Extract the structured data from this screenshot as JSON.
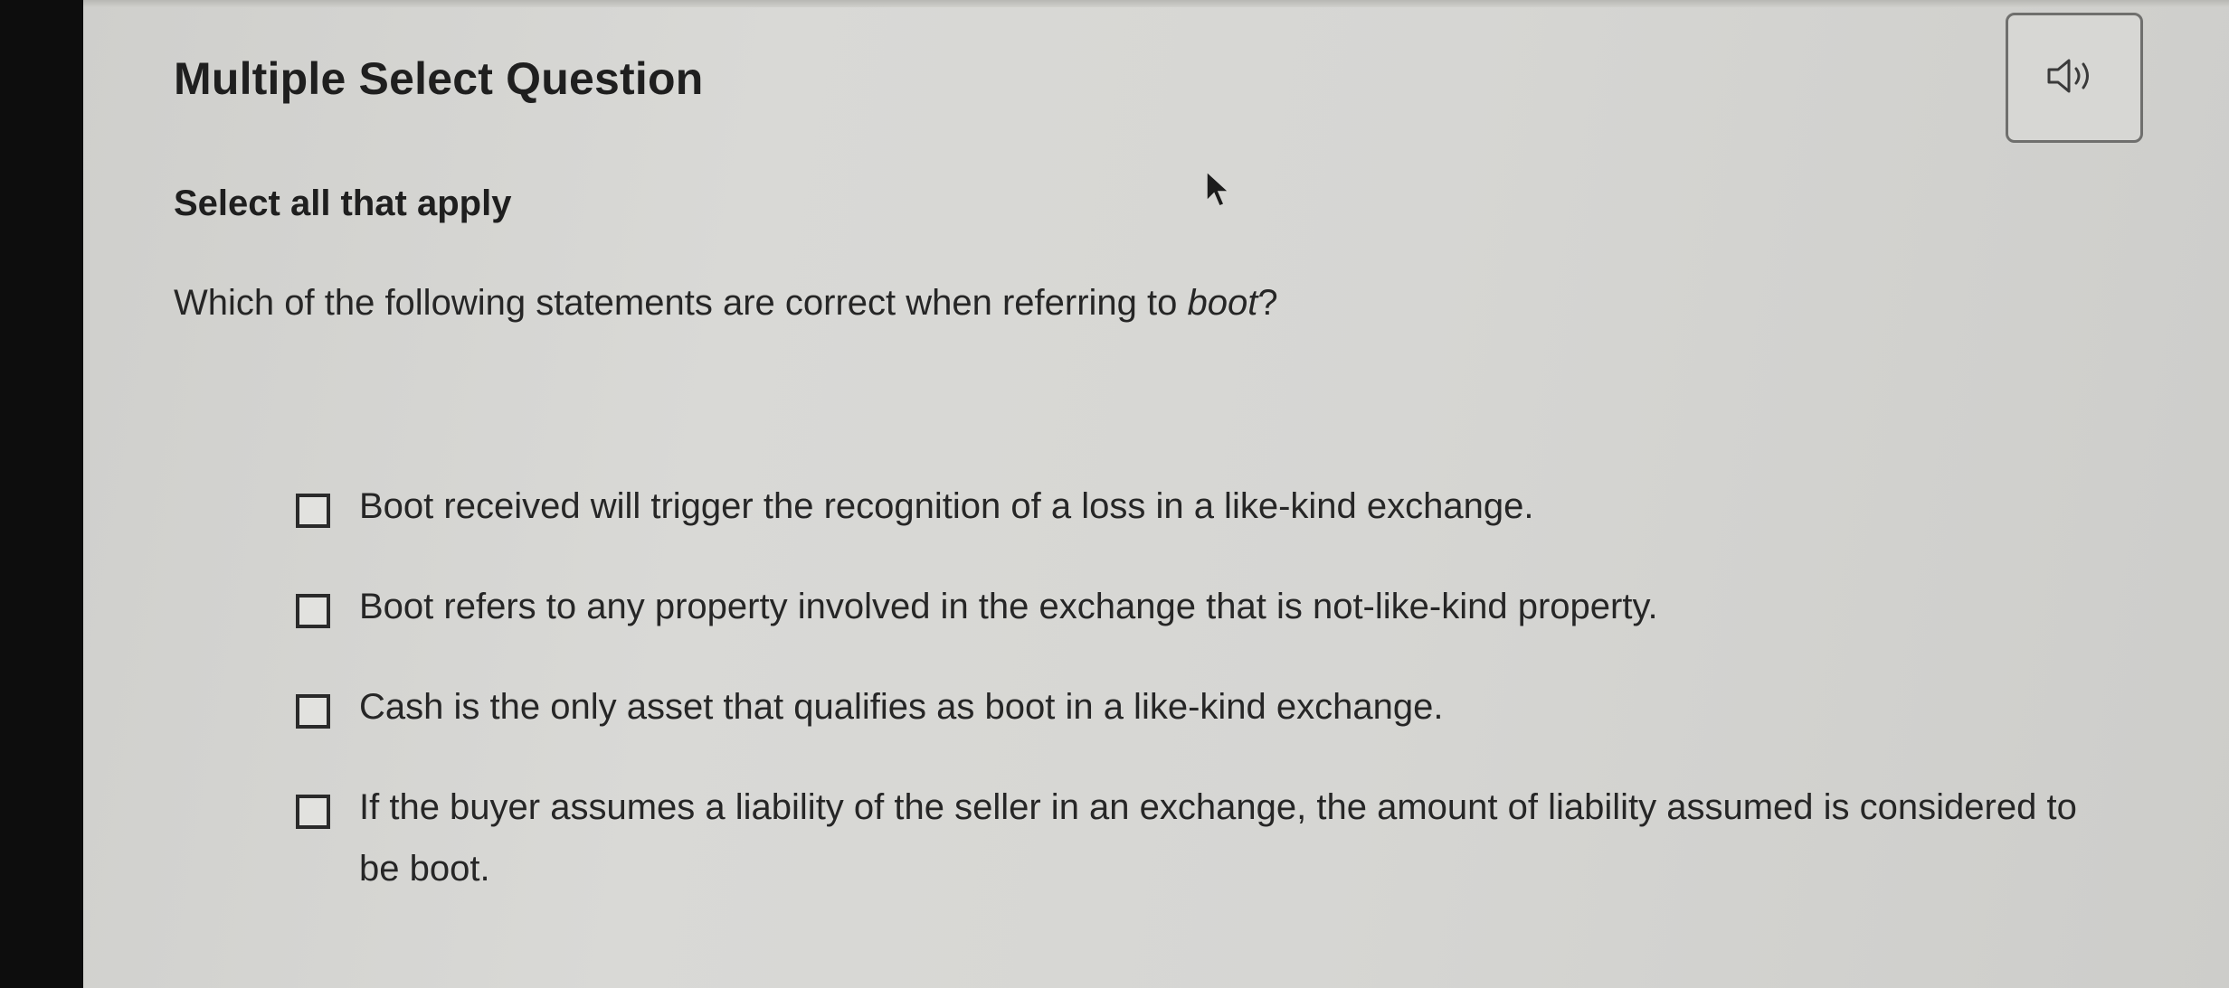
{
  "question": {
    "type_label": "Multiple Select Question",
    "instructions": "Select all that apply",
    "prompt_before": "Which of the following statements are correct when referring to ",
    "prompt_emphasis": "boot",
    "prompt_after": "?"
  },
  "audio_button": {
    "icon": "speaker-icon"
  },
  "options": [
    {
      "label": "Boot received will trigger the recognition of a loss in a like-kind exchange.",
      "checked": false
    },
    {
      "label": "Boot refers to any property involved in the exchange that is not-like-kind property.",
      "checked": false
    },
    {
      "label": "Cash is the only asset that qualifies as boot in a like-kind exchange.",
      "checked": false
    },
    {
      "label": "If the buyer assumes a liability of the seller in an exchange, the amount of liability assumed is considered to be boot.",
      "checked": false
    }
  ]
}
